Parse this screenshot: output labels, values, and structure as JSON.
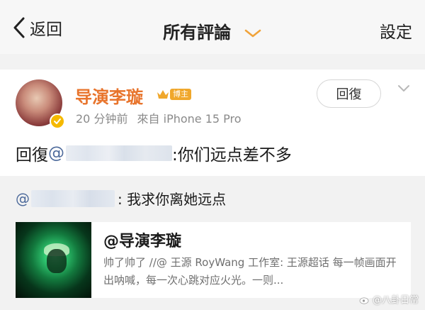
{
  "nav": {
    "back_label": "返回",
    "title": "所有評論",
    "settings_label": "設定"
  },
  "comment": {
    "username": "导演李璇",
    "badge_label": "博主",
    "time": "20 分钟前",
    "source": "來自 iPhone 15 Pro",
    "reply_button": "回復",
    "text_prefix": "回復",
    "mention_prefix": "@",
    "text_body": ":你们远点差不多"
  },
  "quote": {
    "mention_prefix": "@",
    "text_body": ": 我求你离她远点",
    "card_title": "@导演李璇",
    "card_desc": "帅了帅了 //@ 王源 RoyWang 工作室: 王源超话 每一帧画面开出呐喊，每一次心跳对应火光。一则..."
  },
  "watermark": {
    "text": "@八卦日常"
  },
  "colors": {
    "username": "#e8742c",
    "mention": "#4d6a9b",
    "verified": "#f5b900",
    "badge": "#f0a72b",
    "dropdown_chevron": "#f0a33a"
  },
  "icons": [
    "back-chevron-icon",
    "dropdown-chevron-icon",
    "verified-icon",
    "crown-icon",
    "more-chevron-icon",
    "weibo-icon"
  ]
}
